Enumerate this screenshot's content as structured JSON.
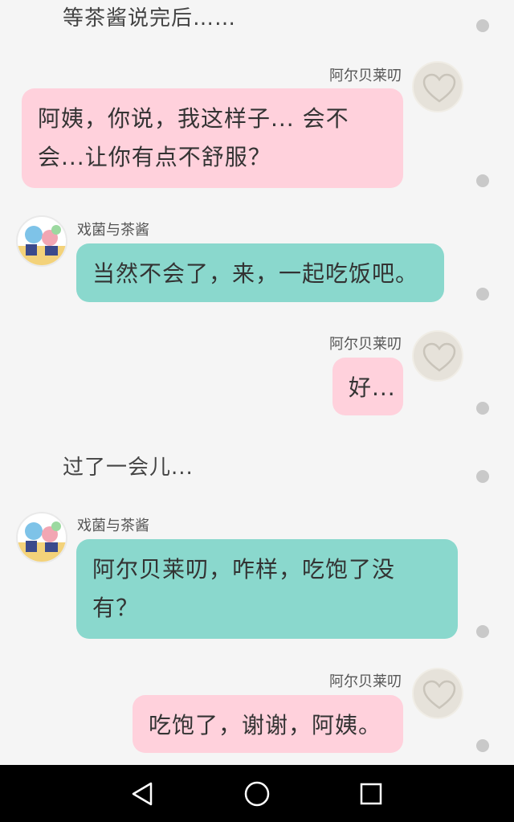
{
  "chat": {
    "narration_1": "等茶酱说完后……",
    "narration_2": "过了一会儿...",
    "messages": [
      {
        "sender": "阿尔贝莱叨",
        "text_lines": [
          "阿姨，你说，我这样子... 会不",
          "会...让你有点不舒服？"
        ]
      },
      {
        "sender": "戏菌与茶酱",
        "text_lines": [
          "当然不会了，来，一起吃饭吧。"
        ]
      },
      {
        "sender": "阿尔贝莱叨",
        "text_lines": [
          "好..."
        ]
      },
      {
        "sender": "戏菌与茶酱",
        "text_lines": [
          "阿尔贝莱叨，咋样，吃饱了没",
          "有？"
        ]
      },
      {
        "sender": "阿尔贝莱叨",
        "text_lines": [
          "吃饱了，谢谢，阿姨。"
        ]
      }
    ]
  },
  "icons": {
    "right_avatar": "heart-avatar-icon",
    "left_avatar": "anime-avatar-icon",
    "nav_back": "back-triangle-icon",
    "nav_home": "home-circle-icon",
    "nav_recent": "recent-square-icon",
    "menu_dot": "more-dot-icon"
  },
  "colors": {
    "pink_bubble": "#ffd1dc",
    "teal_bubble": "#8ad8cd",
    "background": "#f5f5f5",
    "navbar": "#000000"
  }
}
